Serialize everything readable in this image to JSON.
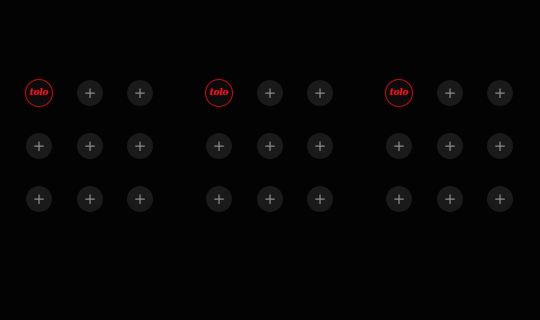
{
  "colors": {
    "background": "#030303",
    "slot_fill": "#1a1a1a",
    "plus_glyph": "#8a8a8a",
    "logo_accent": "#e21b24"
  },
  "logo": {
    "text": "tolo"
  },
  "add_slot": {
    "glyph": "+",
    "icon": "plus-icon"
  }
}
